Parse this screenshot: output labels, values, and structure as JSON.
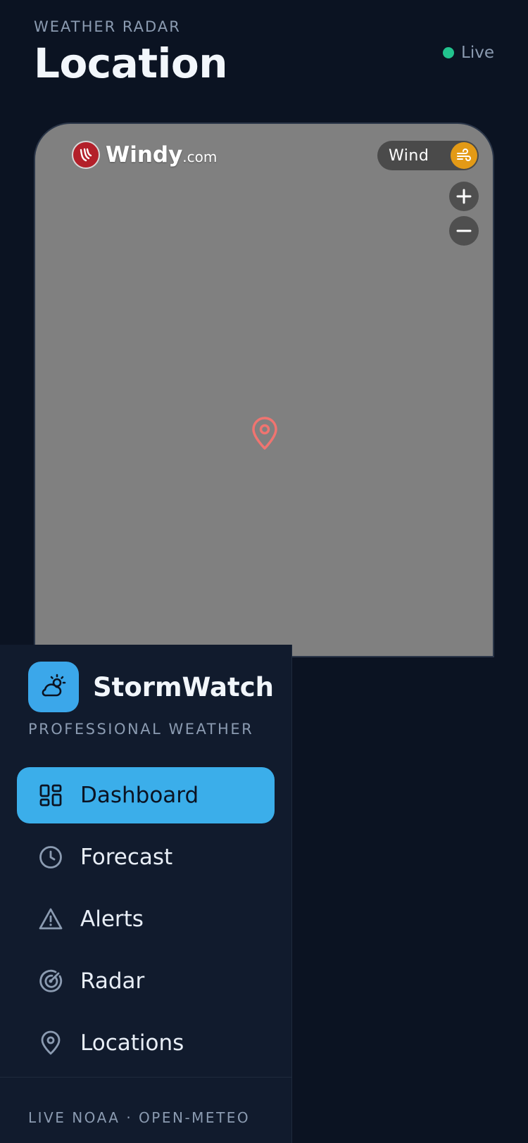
{
  "header": {
    "kicker": "WEATHER RADAR",
    "title": "Location",
    "status": "Live"
  },
  "map": {
    "brand_main": "Windy",
    "brand_suffix": ".com",
    "layer_label": "Wind",
    "zoom_in": "+",
    "zoom_out": "−"
  },
  "sidebar": {
    "brand_name": "StormWatch",
    "brand_sub": "PROFESSIONAL WEATHER",
    "items": [
      {
        "label": "Dashboard",
        "icon": "dashboard-icon",
        "active": true
      },
      {
        "label": "Forecast",
        "icon": "clock-icon",
        "active": false
      },
      {
        "label": "Alerts",
        "icon": "alert-triangle-icon",
        "active": false
      },
      {
        "label": "Radar",
        "icon": "radar-icon",
        "active": false
      },
      {
        "label": "Locations",
        "icon": "map-pin-icon",
        "active": false
      }
    ],
    "footer": "LIVE NOAA · OPEN-METEO"
  },
  "colors": {
    "background": "#0b1322",
    "accent": "#3baeea",
    "live": "#22c38e",
    "wind": "#e39a16"
  }
}
